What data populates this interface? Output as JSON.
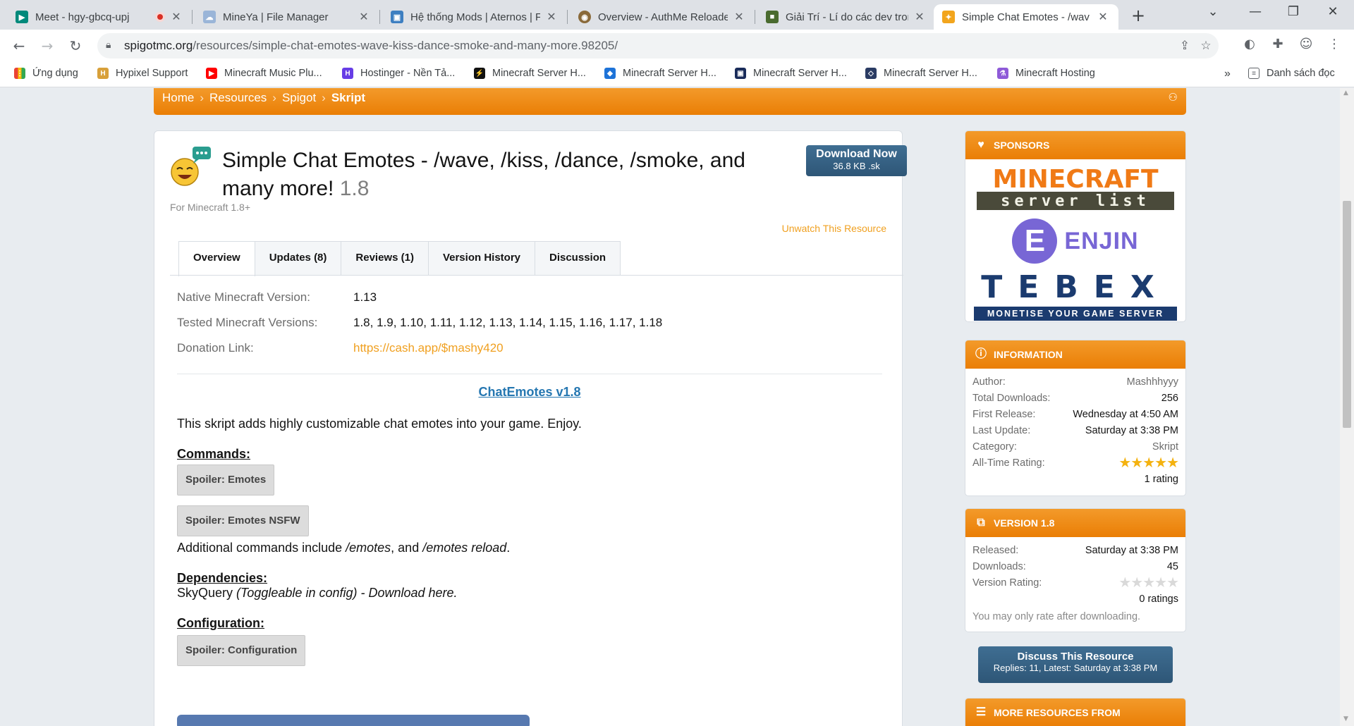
{
  "browser": {
    "tabs": [
      {
        "title": "Meet - hgy-gbcq-upj",
        "icon": "google-meet-icon",
        "recording": true
      },
      {
        "title": "MineYa | File Manager",
        "icon": "cloud-icon"
      },
      {
        "title": "Hệ thống Mods | Aternos | F",
        "icon": "aternos-icon"
      },
      {
        "title": "Overview - AuthMe Reloade",
        "icon": "authme-icon"
      },
      {
        "title": "Giải Trí - Lí do các dev trong",
        "icon": "grass-block-icon"
      },
      {
        "title": "Simple Chat Emotes - /wav",
        "icon": "spigot-icon",
        "active": true
      }
    ],
    "url_host": "spigotmc.org",
    "url_path": "/resources/simple-chat-emotes-wave-kiss-dance-smoke-and-many-more.98205/",
    "bookmarks": [
      {
        "label": "Ứng dụng",
        "icon": "apps-grid-icon"
      },
      {
        "label": "Hypixel Support",
        "icon": "hypixel-icon"
      },
      {
        "label": "Minecraft Music Plu...",
        "icon": "youtube-icon"
      },
      {
        "label": "Hostinger - Nền Tả...",
        "icon": "hostinger-icon"
      },
      {
        "label": "Minecraft Server H...",
        "icon": "bolt-icon"
      },
      {
        "label": "Minecraft Server H...",
        "icon": "cube-blue-icon"
      },
      {
        "label": "Minecraft Server H...",
        "icon": "square-logo-icon"
      },
      {
        "label": "Minecraft Server H...",
        "icon": "cube-outline-icon"
      },
      {
        "label": "Minecraft Hosting",
        "icon": "flask-icon"
      }
    ],
    "reading_list": "Danh sách đọc"
  },
  "breadcrumb": [
    "Home",
    "Resources",
    "Spigot",
    "Skript"
  ],
  "resource": {
    "title": "Simple Chat Emotes - /wave, /kiss, /dance, /smoke, and many more!",
    "version": "1.8",
    "subtitle": "For Minecraft 1.8+",
    "download_label": "Download Now",
    "download_meta": "36.8 KB .sk",
    "unwatch": "Unwatch This Resource",
    "tabs": [
      "Overview",
      "Updates (8)",
      "Reviews (1)",
      "Version History",
      "Discussion"
    ],
    "fields": [
      {
        "label": "Native Minecraft Version:",
        "value": "1.13"
      },
      {
        "label": "Tested Minecraft Versions:",
        "value": "1.8, 1.9, 1.10, 1.11, 1.12, 1.13, 1.14, 1.15, 1.16, 1.17, 1.18"
      },
      {
        "label": "Donation Link:",
        "value": "https://cash.app/$mashy420"
      }
    ],
    "desc_title": "ChatEmotes v1.8",
    "intro": "This skript adds highly customizable chat emotes into your game. Enjoy.",
    "commands_heading": "Commands:",
    "spoiler_emotes": "Spoiler: Emotes",
    "spoiler_nsfw": "Spoiler: Emotes NSFW",
    "additional_pre": "Additional commands include ",
    "additional_cmd1": "/emotes",
    "additional_mid": ", and ",
    "additional_cmd2": "/emotes reload",
    "additional_post": ".",
    "dependencies_heading": "Dependencies:",
    "dep_name": "SkyQuery ",
    "dep_note": "(Toggleable in config) - Download here.",
    "configuration_heading": "Configuration:",
    "spoiler_config": "Spoiler: Configuration"
  },
  "sidebar": {
    "sponsors_title": "SPONSORS",
    "sponsor_mcsl_top": "MINECRAFT",
    "sponsor_mcsl_bottom": "server list",
    "sponsor_enjin_mark": "E",
    "sponsor_enjin": "ENJIN",
    "sponsor_tebex": "TEBEX",
    "sponsor_tebex_tagline": "MONETISE YOUR GAME SERVER",
    "information_title": "INFORMATION",
    "information": [
      {
        "label": "Author:",
        "value": "Mashhhyyy"
      },
      {
        "label": "Total Downloads:",
        "value": "256"
      },
      {
        "label": "First Release:",
        "value": "Wednesday at 4:50 AM"
      },
      {
        "label": "Last Update:",
        "value": "Saturday at 3:38 PM"
      },
      {
        "label": "Category:",
        "value": "Skript"
      }
    ],
    "all_time_rating_label": "All-Time Rating:",
    "all_time_rating": 5,
    "all_time_rating_count": "1 rating",
    "version_title": "VERSION 1.8",
    "version_info": [
      {
        "label": "Released:",
        "value": "Saturday at 3:38 PM"
      },
      {
        "label": "Downloads:",
        "value": "45"
      }
    ],
    "version_rating_label": "Version Rating:",
    "version_rating": 0,
    "version_rating_count": "0 ratings",
    "version_note": "You may only rate after downloading.",
    "discuss_label": "Discuss This Resource",
    "discuss_meta": "Replies: 11, Latest: Saturday at 3:38 PM",
    "more_title": "MORE RESOURCES FROM"
  },
  "colors": {
    "orange": "#ed8106",
    "button_blue": "#2e5677",
    "link_orange": "#f0a020",
    "link_blue": "#2577b1"
  }
}
